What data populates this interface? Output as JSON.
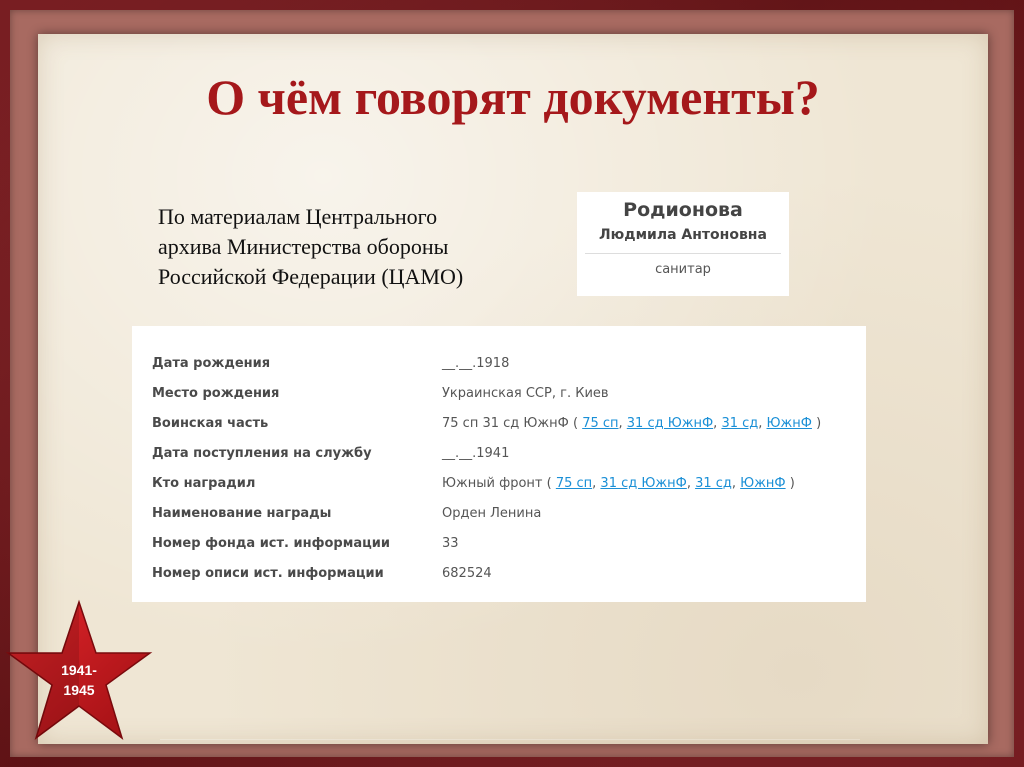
{
  "slide": {
    "title": "О чём говорят документы?",
    "caption": [
      "По материалам Центрального",
      "архива Министерства обороны",
      "Российской Федерации (ЦАМО)"
    ]
  },
  "person": {
    "surname": "Родионова",
    "given_names": "Людмила Антоновна",
    "role": "санитар"
  },
  "record": {
    "rows": [
      {
        "label": "Дата рождения",
        "value": "__.__.1918"
      },
      {
        "label": "Место рождения",
        "value": "Украинская ССР, г. Киев"
      },
      {
        "label": "Воинская часть",
        "value_prefix": "75 сп 31 сд ЮжнФ (",
        "links": [
          "75 сп",
          "31 сд ЮжнФ",
          "31 сд",
          "ЮжнФ"
        ],
        "value_suffix": ")"
      },
      {
        "label": "Дата поступления на службу",
        "value": "__.__.1941"
      },
      {
        "label": "Кто наградил",
        "value_prefix": "Южный фронт (",
        "links": [
          "75 сп",
          "31 сд ЮжнФ",
          "31 сд",
          "ЮжнФ"
        ],
        "value_suffix": ")"
      },
      {
        "label": "Наименование награды",
        "value": "Орден Ленина"
      },
      {
        "label": "Номер фонда ист. информации",
        "value": "33"
      },
      {
        "label": "Номер описи ист. информации",
        "value": "682524"
      }
    ]
  },
  "emblem": {
    "years_top": "1941-",
    "years_bottom": "1945",
    "icon": "red-star-icon"
  },
  "colors": {
    "title": "#a5181b",
    "link": "#1a8fd6",
    "frame": "#7b1a1f",
    "paper": "#efe6d4",
    "star": "#c8161c"
  }
}
